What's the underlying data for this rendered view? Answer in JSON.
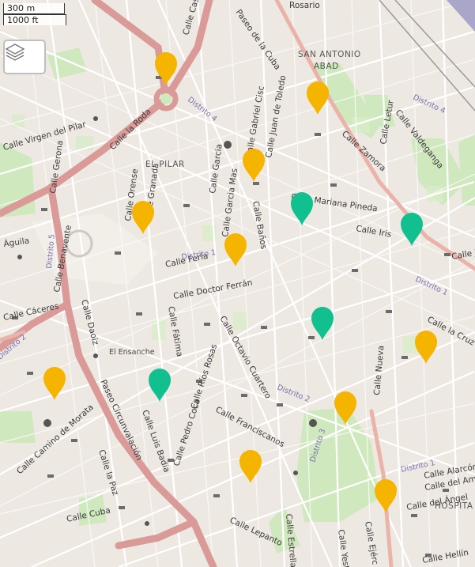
{
  "scale": {
    "metric": "300 m",
    "imperial": "1000 ft"
  },
  "layers_button": {
    "icon": "layers-icon"
  },
  "colors": {
    "marker_orange": "#f5b400",
    "marker_teal": "#12c08f",
    "road_main": "#d98b8b",
    "background": "#efe9e4"
  },
  "areas": {
    "san_antonio": "SAN ANTONIO",
    "abad": "ABAD",
    "el_pilar": "EL PILAR",
    "el_ensanche": "El Ensanche",
    "hospital": "HOSPITA"
  },
  "streets": {
    "casas_ibanez": "Calle Casas Ibañ",
    "paseo_cuba": "Paseo de la Cuba",
    "rosario": "Rosario",
    "gabriel_ciscar": "Calle Gabriel Cisc",
    "juan_toledo": "Calle Juan de Toledo",
    "la_roda": "Calle la Roda",
    "virgen_pilar": "Calle Virgen del Pilar",
    "gerona": "Calle Gerona",
    "orense": "Calle Orense",
    "granada": "de Granada",
    "garcia": "Calle Garcia",
    "garcia_mas": "Calle Garcia Mas",
    "banos": "Calle Baños",
    "mariana_pineda": "Calle Mariana Pineda",
    "iris": "Calle Iris",
    "feria": "Calle Feria",
    "doctor_ferran": "Calle Doctor Ferrán",
    "aguila": "Águila",
    "benavente": "Calle Benavente",
    "caceres": "Calle Cáceres",
    "daoiz": "Calle Daoiz",
    "fatima": "Calle Fátima",
    "octavio_cuartero": "Calle Octavio Cuartero",
    "la_cruz": "Calle la Cruz",
    "rios_rosas": "Calle Ríos Rosas",
    "franciscanos": "Calle Franciscanos",
    "nueva": "Calle Nueva",
    "paseo_circunvalacion": "Paseo Circunvalación",
    "luis_badia": "Calle Luis Badia",
    "pedro_coca": "Calle Pedro Coca",
    "camino_morata": "Calle Camino de Morata",
    "la_paz": "Calle la Paz",
    "cuba": "Calle Cuba",
    "lepanto": "Calle Lepanto",
    "estrella": "Calle Estrella",
    "ejercito": "Calle Ejérc",
    "yeste": "Calle Yeste",
    "alarcon": "Calle Alarcón",
    "del_ampa": "Calle del Ampa",
    "del_angel": "Calle del Ángel",
    "hellin": "Calle Hellín",
    "zamora": "Calle Zamora",
    "letur": "Calle Letur",
    "valdeganga": "Calle Valdeganga",
    "calle_j": "Calle J"
  },
  "districts": {
    "d1": "Distrito 1",
    "d2": "Distrito 2",
    "d3": "Distrito 3",
    "d4": "Distrito 4",
    "d5": "Distrito 5"
  },
  "markers": [
    {
      "id": "m1",
      "color": "orange"
    },
    {
      "id": "m2",
      "color": "orange"
    },
    {
      "id": "m3",
      "color": "orange"
    },
    {
      "id": "m4",
      "color": "orange"
    },
    {
      "id": "m5",
      "color": "orange"
    },
    {
      "id": "m6",
      "color": "teal"
    },
    {
      "id": "m7",
      "color": "teal"
    },
    {
      "id": "m8",
      "color": "teal"
    },
    {
      "id": "m9",
      "color": "orange"
    },
    {
      "id": "m10",
      "color": "orange"
    },
    {
      "id": "m11",
      "color": "teal"
    },
    {
      "id": "m12",
      "color": "orange"
    },
    {
      "id": "m13",
      "color": "orange"
    },
    {
      "id": "m14",
      "color": "orange"
    }
  ]
}
